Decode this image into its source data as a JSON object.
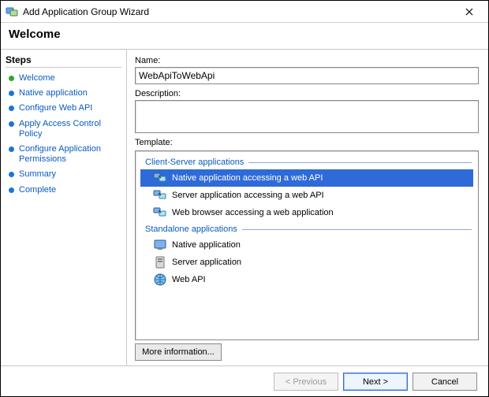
{
  "window": {
    "title": "Add Application Group Wizard"
  },
  "header": {
    "title": "Welcome"
  },
  "sidebar": {
    "title": "Steps",
    "items": [
      {
        "label": "Welcome",
        "current": true
      },
      {
        "label": "Native application",
        "current": false
      },
      {
        "label": "Configure Web API",
        "current": false
      },
      {
        "label": "Apply Access Control Policy",
        "current": false
      },
      {
        "label": "Configure Application Permissions",
        "current": false
      },
      {
        "label": "Summary",
        "current": false
      },
      {
        "label": "Complete",
        "current": false
      }
    ]
  },
  "form": {
    "name_label": "Name:",
    "name_value": "WebApiToWebApi",
    "description_label": "Description:",
    "description_value": "",
    "template_label": "Template:",
    "groups": [
      {
        "title": "Client-Server applications",
        "items": [
          {
            "label": "Native application accessing a web API",
            "icon": "native-webapi-icon",
            "selected": true
          },
          {
            "label": "Server application accessing a web API",
            "icon": "server-webapi-icon",
            "selected": false
          },
          {
            "label": "Web browser accessing a web application",
            "icon": "browser-webapp-icon",
            "selected": false
          }
        ]
      },
      {
        "title": "Standalone applications",
        "items": [
          {
            "label": "Native application",
            "icon": "native-app-icon",
            "selected": false
          },
          {
            "label": "Server application",
            "icon": "server-app-icon",
            "selected": false
          },
          {
            "label": "Web API",
            "icon": "web-api-icon",
            "selected": false
          }
        ]
      }
    ],
    "more_info_label": "More information..."
  },
  "footer": {
    "previous": "< Previous",
    "next": "Next >",
    "cancel": "Cancel"
  }
}
